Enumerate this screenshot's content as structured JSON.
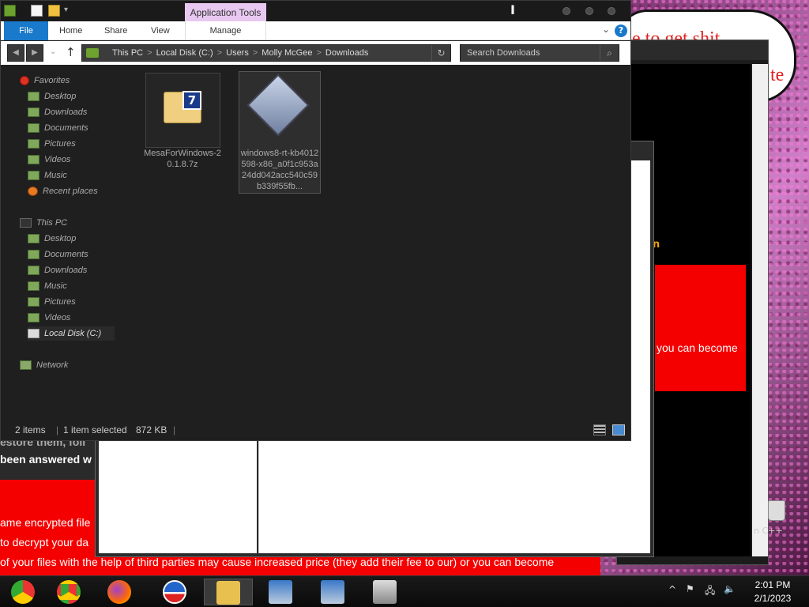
{
  "background": {
    "bubble_text": "e to get shit",
    "bubble_text2": "te",
    "right_window_red_text": "you can become",
    "right_window_orange_text": "n",
    "right_window_small_text": "0",
    "page_lines": [
      "estore them, foll",
      "been answered w",
      "ame encrypted file",
      " to decrypt your da",
      " of your files with the help of third parties may cause increased price (they add their fee to our) or you can become"
    ],
    "desktop_label": "n C++"
  },
  "explorer": {
    "contextual_tab": "Application Tools",
    "ribbon_tabs": [
      "File",
      "Home",
      "Share",
      "View",
      "Manage"
    ],
    "help_label": "?",
    "address": {
      "crumbs": [
        "This PC",
        "Local Disk (C:)",
        "Users",
        "Molly McGee",
        "Downloads"
      ],
      "separator": ">"
    },
    "search_placeholder": "Search Downloads",
    "nav": {
      "favorites_label": "Favorites",
      "favorites": [
        "Desktop",
        "Downloads",
        "Documents",
        "Pictures",
        "Videos",
        "Music",
        "Recent places"
      ],
      "thispc_label": "This PC",
      "thispc": [
        "Desktop",
        "Documents",
        "Downloads",
        "Music",
        "Pictures",
        "Videos",
        "Local Disk (C:)"
      ],
      "network_label": "Network"
    },
    "files": [
      {
        "name": "MesaForWindows-20.1.8.7z",
        "icon": "7zip-archive-icon"
      },
      {
        "name": "windows8-rt-kb4012598-x86_a0f1c953a24dd042acc540c59b339f55fb...",
        "icon": "msu-update-package-icon"
      }
    ],
    "status": {
      "items": "2 items",
      "selected": "1 item selected",
      "size": "872 KB"
    }
  },
  "taskbar": {
    "apps": [
      "chrome-old-icon",
      "chrome-icon",
      "firefox-icon",
      "obama-logo-icon",
      "file-explorer-icon",
      "setup-icon",
      "setup-icon-2",
      "archive-icon"
    ],
    "time": "2:01 PM",
    "date": "2/1/2023"
  }
}
